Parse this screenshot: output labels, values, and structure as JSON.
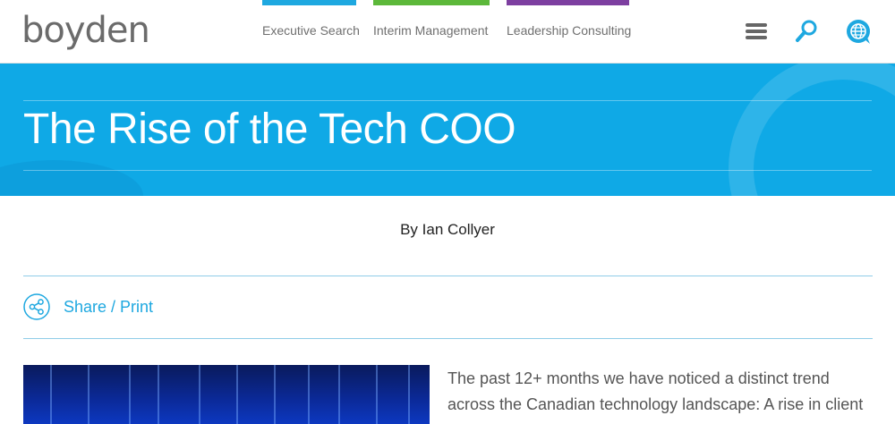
{
  "header": {
    "logo_text": "boyden",
    "nav": [
      {
        "label": "Executive Search",
        "color": "#1ea8e0"
      },
      {
        "label": "Interim Management",
        "color": "#5cb83a"
      },
      {
        "label": "Leadership Consulting",
        "color": "#7d3fa0"
      }
    ],
    "icons": [
      "menu-icon",
      "search-icon",
      "globe-icon"
    ]
  },
  "hero": {
    "title": "The Rise of the Tech COO",
    "background_color": "#0fa9e6"
  },
  "article": {
    "byline": "By Ian Collyer",
    "share_label": "Share / Print",
    "intro": "The past 12+ months we have noticed a distinct trend across the Canadian technology landscape: A rise in client"
  },
  "colors": {
    "accent": "#1ea8e0",
    "divider": "#8fcde8"
  }
}
